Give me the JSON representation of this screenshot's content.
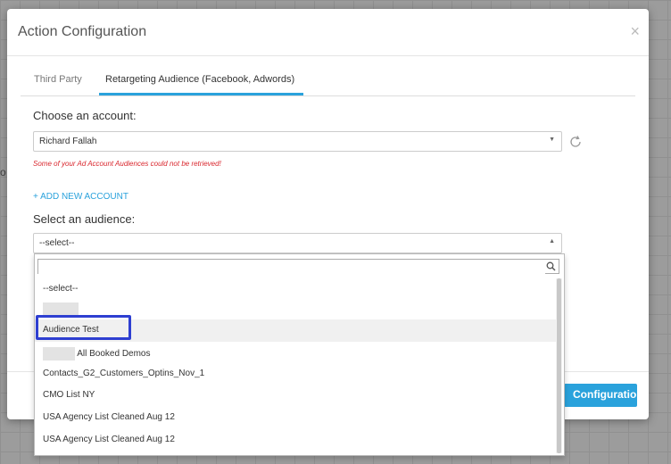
{
  "modal": {
    "title": "Action Configuration",
    "close_label": "×"
  },
  "tabs": [
    {
      "label": "Third Party",
      "active": false
    },
    {
      "label": "Retargeting Audience (Facebook, Adwords)",
      "active": true
    }
  ],
  "account": {
    "label": "Choose an account:",
    "selected": "Richard Fallah",
    "caret": "▼",
    "error": "Some of your Ad Account Audiences could not be retrieved!",
    "add_link": "+ ADD NEW ACCOUNT"
  },
  "audience": {
    "label": "Select an audience:",
    "selected": "--select--",
    "caret": "▲",
    "search_placeholder": "",
    "options": [
      "--select--",
      "",
      "Audience Test",
      "All Booked Demos",
      "Contacts_G2_Customers_Optins_Nov_1",
      "CMO List NY",
      "USA Agency List Cleaned Aug 12",
      "USA Agency List Cleaned Aug 12"
    ],
    "highlighted_option": "Audience Test"
  },
  "footer": {
    "save_label": "Configuration"
  },
  "background_fragment": "o",
  "colors": {
    "accent": "#2aa2dc",
    "error": "#d9272e",
    "annotation_box": "#2e3fd1"
  },
  "icons": [
    "close-icon",
    "chevron-down-icon",
    "refresh-icon",
    "chevron-up-icon",
    "search-icon"
  ]
}
